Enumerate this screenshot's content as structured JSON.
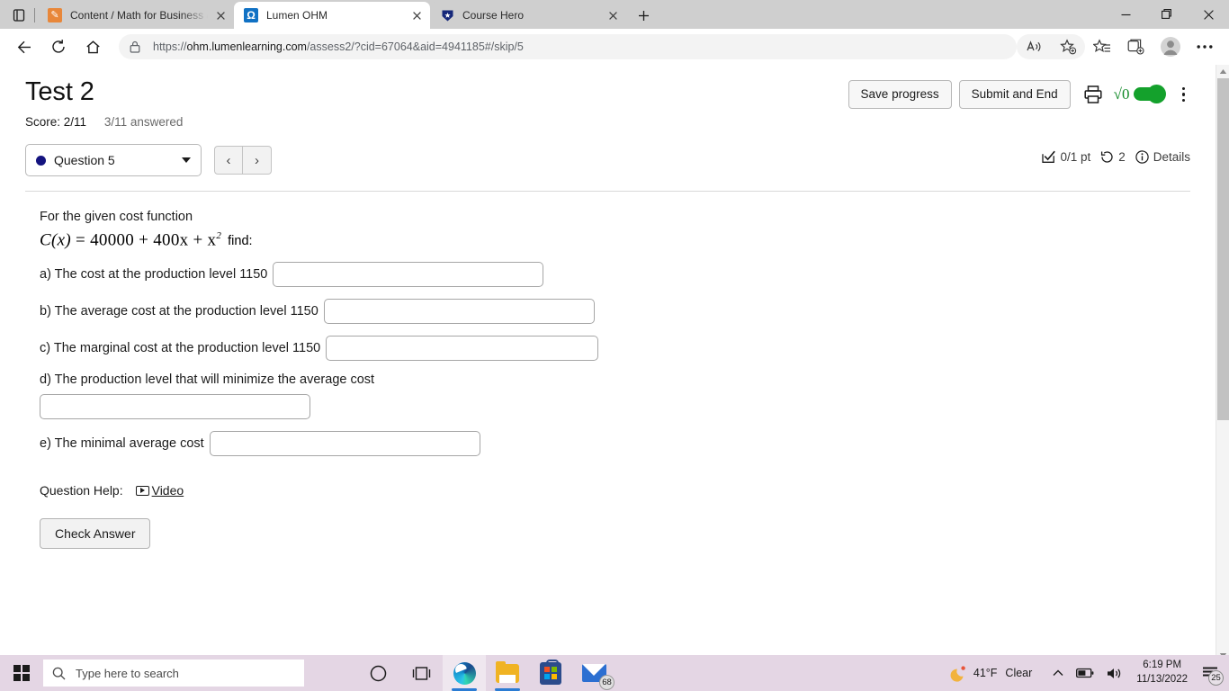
{
  "browser": {
    "tabs": [
      {
        "title": "Content / Math for Business & S",
        "favicon": "pencil-icon",
        "active": false
      },
      {
        "title": "Lumen OHM",
        "favicon": "omega-icon",
        "active": true
      },
      {
        "title": "Course Hero",
        "favicon": "shield-star-icon",
        "active": false
      }
    ],
    "new_tab_label": "+",
    "url": "https://ohm.lumenlearning.com/assess2/?cid=67064&aid=4941185#/skip/5",
    "url_host": "ohm.lumenlearning.com",
    "url_rest": "/assess2/?cid=67064&aid=4941185#/skip/5",
    "url_scheme": "https://",
    "window_controls": {
      "minimize": "—",
      "maximize": "❐",
      "close": "✕"
    }
  },
  "page": {
    "title": "Test 2",
    "score_label": "Score: 2/11",
    "answered_label": "3/11 answered",
    "actions": {
      "save_label": "Save progress",
      "submit_label": "Submit and End",
      "math_toggle_symbol": "√0",
      "math_toggle_state": "on",
      "toggle_color": "#14a12c"
    },
    "question_nav": {
      "selected_question": "Question 5",
      "dot_color": "#14137f",
      "prev_label": "‹",
      "next_label": "›",
      "points": "0/1 pt",
      "attempts": "2",
      "details_label": "Details"
    },
    "question": {
      "intro": "For the given cost function",
      "formula_lhs": "C(x)",
      "formula_eq": "=",
      "formula_rhs": "40000 + 400x + x",
      "formula_exp": "2",
      "formula_tail": "find:",
      "parts": [
        {
          "label": "a) The cost at the production level 1150",
          "value": "",
          "layout": "inline"
        },
        {
          "label": "b) The average cost at the production level 1150",
          "value": "",
          "layout": "inline"
        },
        {
          "label": "c) The marginal cost at the production level 1150",
          "value": "",
          "layout": "inline"
        },
        {
          "label": "d) The production level that will minimize the average cost",
          "value": "",
          "layout": "stacked"
        },
        {
          "label": "e) The minimal average cost",
          "value": "",
          "layout": "inline"
        }
      ],
      "help_label": "Question Help:",
      "video_link": "Video",
      "check_answer_label": "Check Answer"
    }
  },
  "taskbar": {
    "search_placeholder": "Type here to search",
    "apps": [
      {
        "name": "cortana-icon"
      },
      {
        "name": "task-view-icon"
      },
      {
        "name": "edge-icon"
      },
      {
        "name": "file-explorer-icon"
      },
      {
        "name": "microsoft-store-icon"
      },
      {
        "name": "mail-icon",
        "badge": "68"
      }
    ],
    "weather_temp": "41°F",
    "weather_cond": "Clear",
    "time": "6:19 PM",
    "date": "11/13/2022",
    "notification_count": "25",
    "background_color": "#e4d6e4"
  }
}
